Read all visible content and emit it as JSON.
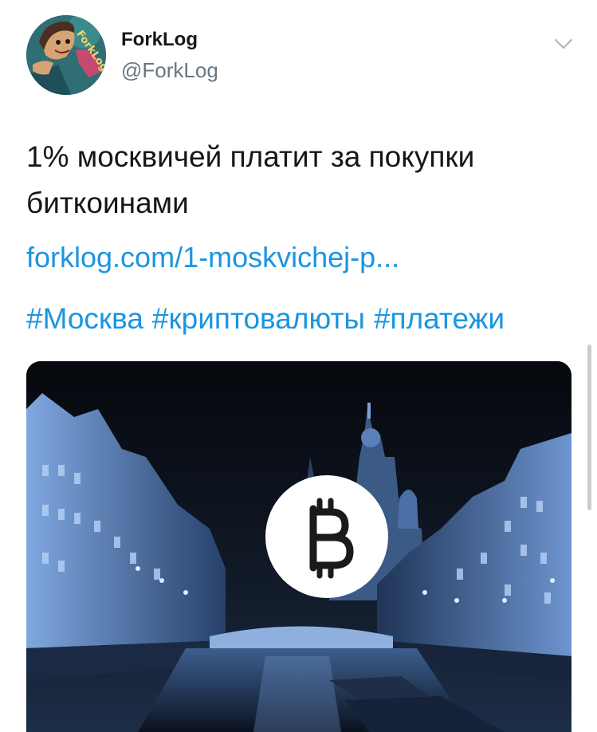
{
  "tweet": {
    "author": {
      "display_name": "ForkLog",
      "handle": "@ForkLog",
      "avatar_text": "ForkLog"
    },
    "text": "1% москвичей платит за покупки биткоинами",
    "link": "forklog.com/1-moskvichej-p...",
    "hashtags": [
      "#Москва",
      "#криптовалюты",
      "#платежи"
    ],
    "media": {
      "icon": "bitcoin-icon",
      "scene": "night-canal-city-icon"
    }
  },
  "colors": {
    "text": "#14171a",
    "secondary": "#657786",
    "link": "#1b95e0",
    "avatar_bg": "#2f6f73",
    "media_tint": "#6fa0dc"
  }
}
